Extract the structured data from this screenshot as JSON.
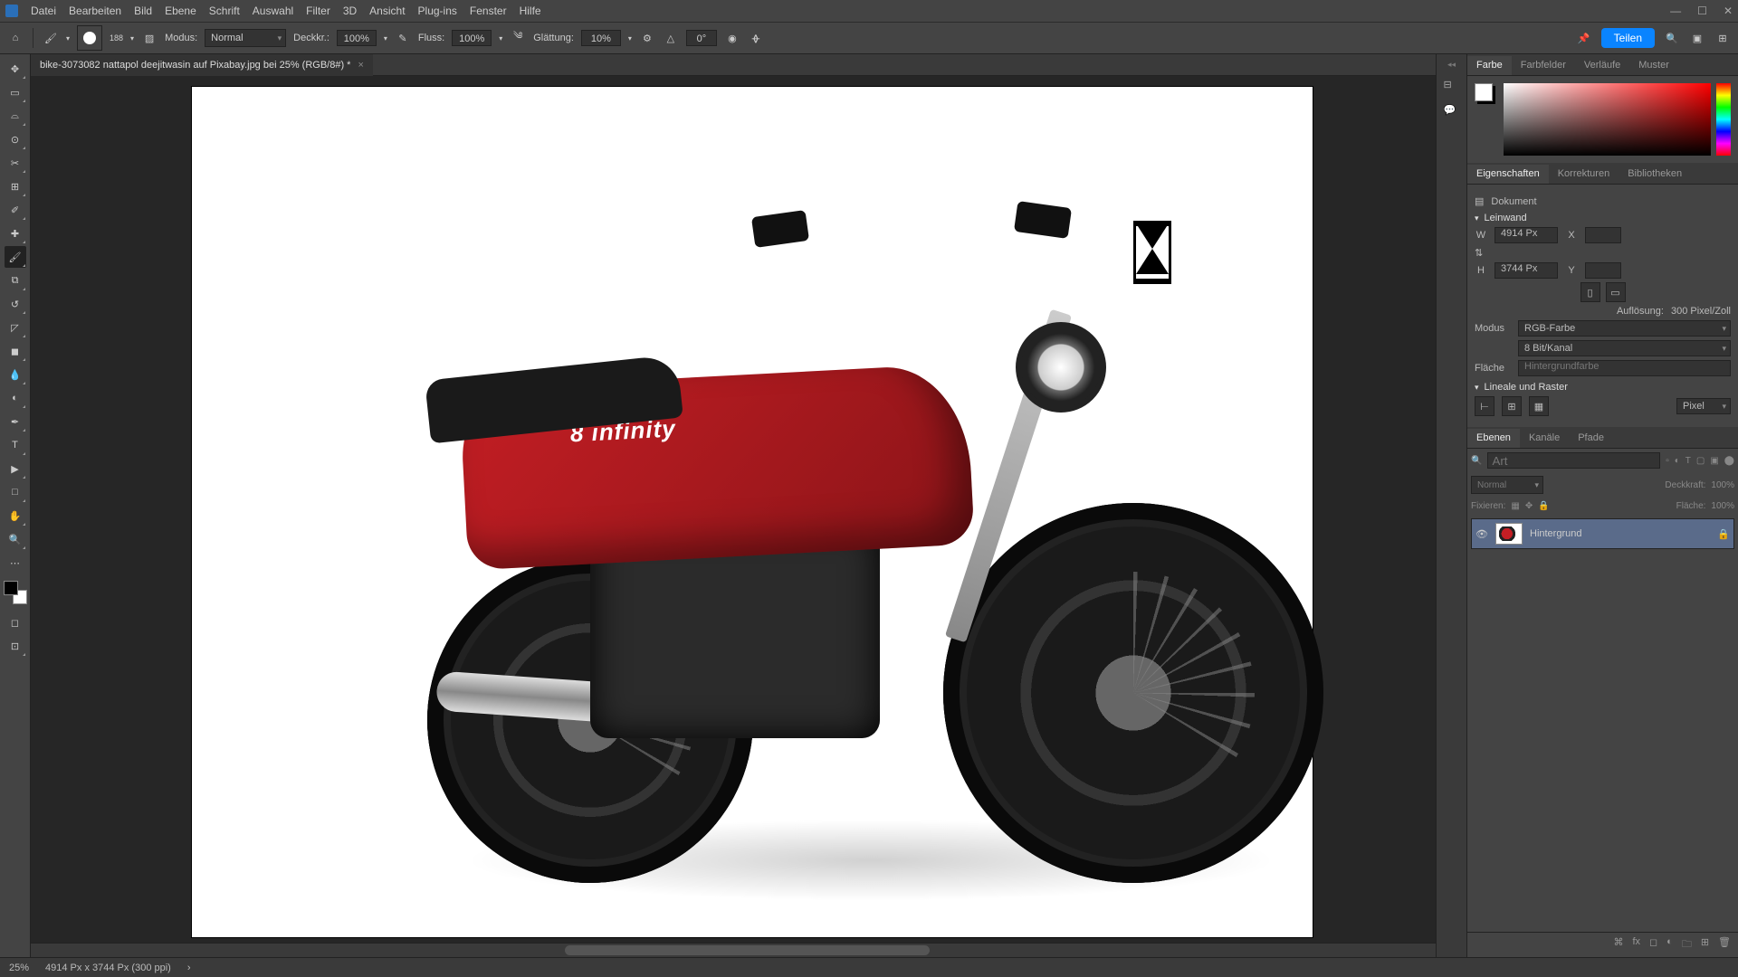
{
  "menu": {
    "items": [
      "Datei",
      "Bearbeiten",
      "Bild",
      "Ebene",
      "Schrift",
      "Auswahl",
      "Filter",
      "3D",
      "Ansicht",
      "Plug-ins",
      "Fenster",
      "Hilfe"
    ]
  },
  "optbar": {
    "brush_size": "188",
    "modus_label": "Modus:",
    "modus_value": "Normal",
    "opacity_label": "Deckkr.:",
    "opacity_value": "100%",
    "flow_label": "Fluss:",
    "flow_value": "100%",
    "smooth_label": "Glättung:",
    "smooth_value": "10%",
    "angle_icon": "△",
    "angle_value": "0°",
    "share": "Teilen"
  },
  "document": {
    "tab_title": "bike-3073082 nattapol deejitwasin auf Pixabay.jpg bei 25% (RGB/8#) *"
  },
  "panels": {
    "color_tabs": [
      "Farbe",
      "Farbfelder",
      "Verläufe",
      "Muster"
    ],
    "props_tabs": [
      "Eigenschaften",
      "Korrekturen",
      "Bibliotheken"
    ],
    "props": {
      "doc_label": "Dokument",
      "canvas_section": "Leinwand",
      "w_label": "W",
      "w_val": "4914 Px",
      "x_label": "X",
      "h_label": "H",
      "h_val": "3744 Px",
      "y_label": "Y",
      "res_label": "Auflösung:",
      "res_val": "300 Pixel/Zoll",
      "mode_label": "Modus",
      "mode_val": "RGB-Farbe",
      "depth_val": "8 Bit/Kanal",
      "fill_label": "Fläche",
      "fill_val": "Hintergrundfarbe",
      "rulers_section": "Lineale und Raster",
      "units": "Pixel"
    },
    "layers_tabs": [
      "Ebenen",
      "Kanäle",
      "Pfade"
    ],
    "layers_opts": {
      "search_placeholder": "Art",
      "blend": "Normal",
      "opacity_label": "Deckkraft:",
      "opacity_val": "100%",
      "lock_label": "Fixieren:",
      "fill_label": "Fläche:",
      "fill_val": "100%"
    },
    "layer0": "Hintergrund"
  },
  "status": {
    "zoom": "25%",
    "dims": "4914 Px x 3744 Px (300 ppi)"
  }
}
